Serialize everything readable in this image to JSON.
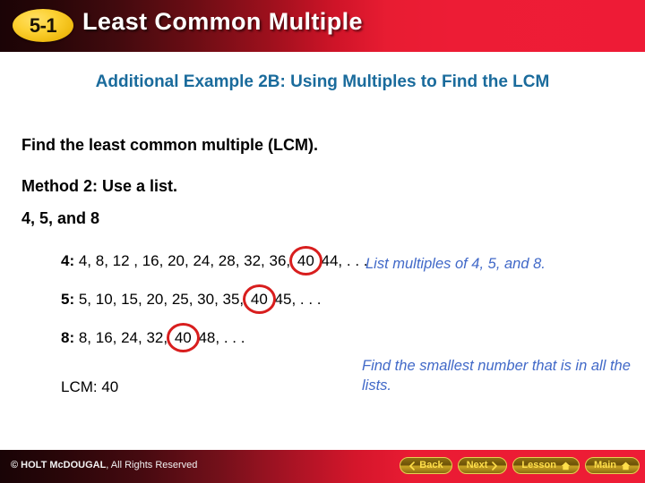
{
  "header": {
    "badge": "5-1",
    "title": "Least Common Multiple",
    "accent_color": "#ed1c35",
    "badge_color": "#fcd133"
  },
  "slide": {
    "subtitle": "Additional Example 2B: Using Multiples to Find the LCM",
    "subtitle_color": "#1a6b9c",
    "lead_lines": [
      "Find the least common multiple (LCM).",
      "Method 2: Use a list.",
      "4, 5, and 8"
    ],
    "lists": [
      {
        "label": "4:",
        "before": " 4, 8, 12 , 16, 20, 24, 28, 32, 36, ",
        "circled": "40",
        "after": " 44, . . ."
      },
      {
        "label": "5:",
        "before": " 5, 10, 15, 20, 25, 30, 35, ",
        "circled": "40",
        "after": " 45, . . ."
      },
      {
        "label": "8:",
        "before": " 8, 16, 24, 32, ",
        "circled": "40",
        "after": " 48, . . ."
      }
    ],
    "lcm_result": "LCM: 40",
    "callouts": [
      "List multiples of 4, 5, and 8.",
      "Find the smallest number that is in all the lists."
    ],
    "callout_color": "#4169c8",
    "circle_color": "#d81e1e"
  },
  "footer": {
    "copyright_bold": "© HOLT McDOUGAL",
    "copyright_rest": ", All Rights Reserved",
    "buttons": [
      {
        "label": "Back",
        "icon": "chevron-left-icon",
        "icon_side": "left"
      },
      {
        "label": "Next",
        "icon": "chevron-right-icon",
        "icon_side": "right"
      },
      {
        "label": "Lesson",
        "icon": "home-icon",
        "icon_side": "right"
      },
      {
        "label": "Main",
        "icon": "home-icon",
        "icon_side": "right"
      }
    ]
  }
}
